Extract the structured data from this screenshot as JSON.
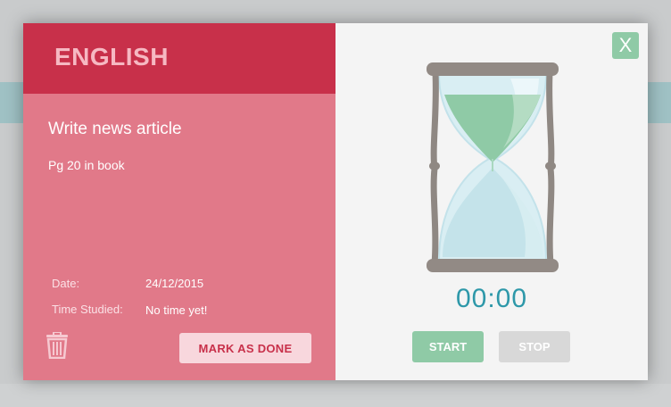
{
  "subject": "ENGLISH",
  "task": {
    "title": "Write news article",
    "description": "Pg 20 in book"
  },
  "meta": {
    "date_label": "Date:",
    "date_value": "24/12/2015",
    "time_label": "Time Studied:",
    "time_value": "No time yet!"
  },
  "actions": {
    "mark_done_label": "MARK AS DONE",
    "delete_icon": "trash-icon"
  },
  "timer": {
    "display": "00:00",
    "start_label": "START",
    "stop_label": "STOP",
    "close_label": "X"
  },
  "colors": {
    "header_red": "#c8304a",
    "panel_pink": "#e17989",
    "accent_green": "#8fcaa6",
    "timer_teal": "#2e98a9",
    "stop_gray": "#d8d8d8"
  }
}
